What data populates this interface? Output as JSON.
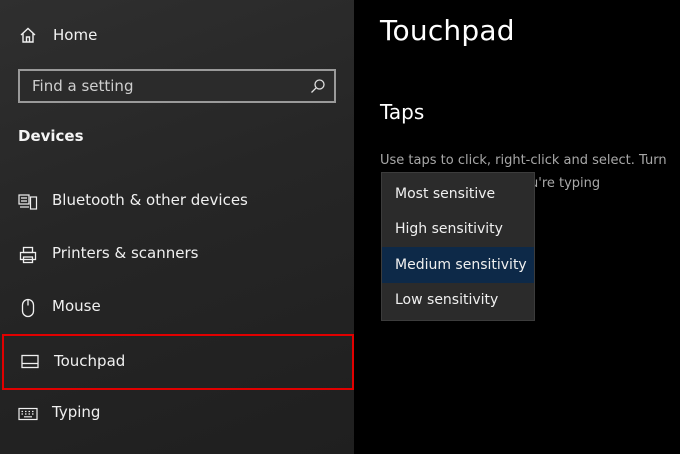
{
  "sidebar": {
    "home_label": "Home",
    "search_placeholder": "Find a setting",
    "section_title": "Devices",
    "items": [
      {
        "label": "Bluetooth & other devices",
        "icon": "bluetooth-devices-icon"
      },
      {
        "label": "Printers & scanners",
        "icon": "printer-icon"
      },
      {
        "label": "Mouse",
        "icon": "mouse-icon"
      },
      {
        "label": "Touchpad",
        "icon": "touchpad-icon",
        "selected": true
      },
      {
        "label": "Typing",
        "icon": "keyboard-icon"
      }
    ]
  },
  "main": {
    "title": "Touchpad",
    "taps_heading": "Taps",
    "taps_desc_line1": "Use taps to click, right-click and select. Turn",
    "taps_desc_line2_visible": "u're typing",
    "sensitivity_options": [
      "Most sensitive",
      "High sensitivity",
      "Medium sensitivity",
      "Low sensitivity"
    ],
    "selected_option": "Medium sensitivity"
  },
  "colors": {
    "sidebar_bg": "#2a2a2a",
    "main_bg": "#000000",
    "selection_border": "#e10000",
    "dropdown_bg": "#2b2b2b",
    "dropdown_highlight": "#0d2948"
  }
}
